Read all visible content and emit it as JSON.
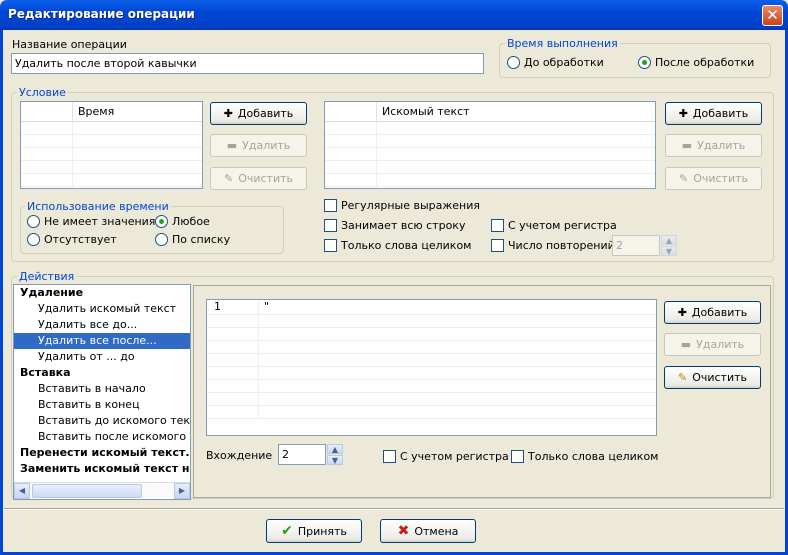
{
  "window": {
    "title": "Редактирование операции",
    "close": "✕"
  },
  "op_name": {
    "label": "Название операции",
    "value": "Удалить после второй кавычки"
  },
  "exec_time": {
    "label": "Время выполнения",
    "before": "До обработки",
    "after": "После обработки",
    "selected": "after"
  },
  "condition": {
    "label": "Условие",
    "time_grid": {
      "header": "Время"
    },
    "text_grid": {
      "header": "Искомый текст"
    },
    "add": "Добавить",
    "delete": "Удалить",
    "clear": "Очистить",
    "time_usage": {
      "label": "Использование времени",
      "opt1": "Не имеет значения",
      "opt2": "Любое",
      "opt3": "Отсутствует",
      "opt4": "По списку",
      "selected": "opt2"
    },
    "regex": "Регулярные выражения",
    "whole_line": "Занимает всю строку",
    "whole_words": "Только слова целиком",
    "case": "С учетом регистра",
    "repeat": "Число повторений",
    "repeat_value": "2"
  },
  "actions": {
    "label": "Действия",
    "tree": [
      {
        "text": "Удаление",
        "kind": "h"
      },
      {
        "text": "Удалить искомый текст",
        "kind": "c"
      },
      {
        "text": "Удалить все до...",
        "kind": "c"
      },
      {
        "text": "Удалить все после...",
        "kind": "c",
        "selected": true
      },
      {
        "text": "Удалить от ... до",
        "kind": "c"
      },
      {
        "text": "Вставка",
        "kind": "h"
      },
      {
        "text": "Вставить в начало",
        "kind": "c"
      },
      {
        "text": "Вставить в конец",
        "kind": "c"
      },
      {
        "text": "Вставить до искомого текста",
        "kind": "c"
      },
      {
        "text": "Вставить после искомого текста",
        "kind": "c"
      },
      {
        "text": "Перенести искомый текст...",
        "kind": "h"
      },
      {
        "text": "Заменить искомый текст на...",
        "kind": "h"
      }
    ],
    "grid_row": {
      "num": "1",
      "value": "\""
    },
    "add": "Добавить",
    "delete": "Удалить",
    "clear": "Очистить",
    "occurrence_label": "Вхождение",
    "occurrence_value": "2",
    "case": "С учетом регистра",
    "whole_words": "Только слова целиком"
  },
  "footer": {
    "ok": "Принять",
    "cancel": "Отмена"
  }
}
